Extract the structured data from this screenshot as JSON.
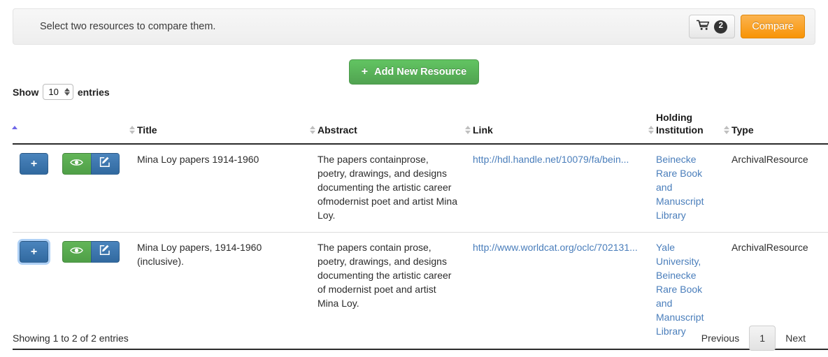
{
  "alert": {
    "message": "Select two resources to compare them.",
    "cart_icon": "shopping-cart-icon",
    "cart_count": "2",
    "compare_label": "Compare"
  },
  "toolbar": {
    "add_plus": "+",
    "add_label": "Add New Resource"
  },
  "length_menu": {
    "prefix": "Show",
    "value": "10",
    "suffix": "entries"
  },
  "table": {
    "columns": [
      {
        "label": "",
        "sort": "asc"
      },
      {
        "label": "Title",
        "sort": "none"
      },
      {
        "label": "Abstract",
        "sort": "none"
      },
      {
        "label": "Link",
        "sort": "none"
      },
      {
        "label": "Holding Institution",
        "sort": "none"
      },
      {
        "label": "Type",
        "sort": "none"
      }
    ],
    "rows": [
      {
        "add_label": "+",
        "view_icon": "eye-icon",
        "edit_icon": "pen-to-square-icon",
        "title": "Mina Loy papers 1914-1960",
        "abstract": "The papers containprose, poetry, drawings, and designs documenting the artistic career ofmodernist poet and artist Mina Loy.",
        "link": "http://hdl.handle.net/10079/fa/bein...",
        "holding_institution": "Beinecke Rare Book and Manuscript Library",
        "type": "ArchivalResource",
        "focused": false
      },
      {
        "add_label": "+",
        "view_icon": "eye-icon",
        "edit_icon": "pen-to-square-icon",
        "title": "Mina Loy papers, 1914-1960 (inclusive).",
        "abstract": "The papers contain prose, poetry, drawings, and designs documenting the artistic career of modernist poet and artist Mina Loy.",
        "link": "http://www.worldcat.org/oclc/702131...",
        "holding_institution": "Yale University, Beinecke Rare Book and Manuscript Library",
        "type": "ArchivalResource",
        "focused": true
      }
    ]
  },
  "footer": {
    "info": "Showing 1 to 2 of 2 entries",
    "previous": "Previous",
    "page": "1",
    "next": "Next"
  },
  "colors": {
    "accent_orange": "#f89406",
    "accent_green": "#51a351",
    "accent_blue": "#31699f",
    "link_blue": "#4a7ebb",
    "sort_active": "#6f67e8"
  }
}
